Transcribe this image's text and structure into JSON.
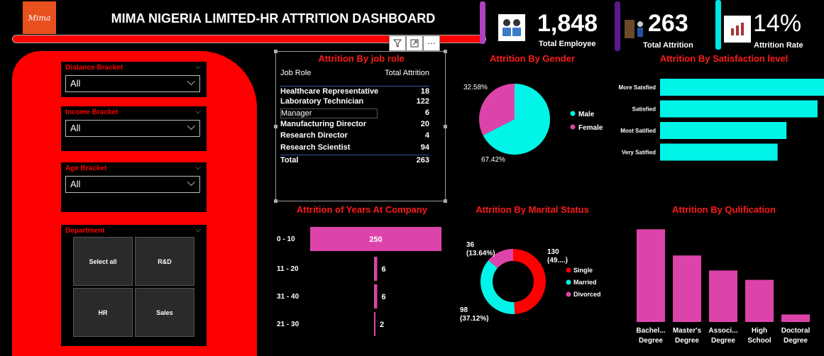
{
  "header": {
    "logo_text": "Mima",
    "title": "MIMA NIGERIA LIMITED-HR ATTRITION DASHBOARD"
  },
  "visual_toolbar": [
    "filter-icon",
    "focus-mode-icon",
    "more-options-icon"
  ],
  "kpis": [
    {
      "value": "1,848",
      "label": "Total Employee",
      "accent": "#b040c0",
      "icon": "employees-icon"
    },
    {
      "value": "263",
      "label": "Total Attrition",
      "accent": "#5a1a8a",
      "icon": "exit-icon"
    },
    {
      "value": "14%",
      "label": "Attrition Rate",
      "accent": "#00e5e5",
      "icon": "rate-icon"
    }
  ],
  "slicers": {
    "distance": {
      "title": "Distance Bracket",
      "value": "All"
    },
    "income": {
      "title": "Income Bracket",
      "value": "All"
    },
    "age": {
      "title": "Age Bracket",
      "value": "All"
    },
    "department": {
      "title": "Department",
      "options": [
        "Select all",
        "R&D",
        "HR",
        "Sales"
      ]
    }
  },
  "job_role": {
    "title": "Attrition By job role",
    "headers": [
      "Job Role",
      "Total Attrition"
    ],
    "rows": [
      {
        "role": "Healthcare Representative",
        "value": "18"
      },
      {
        "role": "Laboratory Technician",
        "value": "122"
      },
      {
        "role": "Manager",
        "value": "6"
      },
      {
        "role": "Manufacturing Director",
        "value": "20"
      },
      {
        "role": "Research Director",
        "value": "4"
      },
      {
        "role": "Research Scientist",
        "value": "94"
      }
    ],
    "total_label": "Total",
    "total_value": "263"
  },
  "colors": {
    "accent_red": "#ff0000",
    "cyan": "#00f5e8",
    "pink": "#dd44aa",
    "title_red": "#ff1a1a"
  },
  "chart_data": [
    {
      "type": "pie",
      "title": "Attrition By Gender",
      "categories": [
        "Male",
        "Female"
      ],
      "values": [
        67.42,
        32.58
      ],
      "labels": [
        "67.42%",
        "32.58%"
      ],
      "colors": [
        "#00f5e8",
        "#dd44aa"
      ],
      "legend": "right"
    },
    {
      "type": "bar",
      "orientation": "horizontal",
      "title": "Attrition By Satisfaction level",
      "categories": [
        "More Satsfied",
        "Satisfied",
        "Most Satified",
        "Very Satified"
      ],
      "values": [
        77,
        71,
        57,
        53
      ],
      "xlim": [
        0,
        80
      ],
      "color": "#00f5e8"
    },
    {
      "type": "bar",
      "orientation": "horizontal",
      "title": "Attrition of Years At Company",
      "categories": [
        "0 - 10",
        "11 - 20",
        "31 - 40",
        "21 - 30"
      ],
      "values": [
        250,
        6,
        6,
        2
      ],
      "data_labels": [
        "250",
        "6",
        "6",
        "2"
      ],
      "xlim": [
        0,
        250
      ],
      "color": "#dd44aa"
    },
    {
      "type": "pie",
      "donut": true,
      "title": "Attrition By Marital Status",
      "categories": [
        "Single",
        "Married",
        "Divorced"
      ],
      "values": [
        130,
        98,
        36
      ],
      "labels": [
        "130\n(49....)",
        "98\n(37.12%)",
        "36\n(13.64%)"
      ],
      "colors": [
        "#ff0000",
        "#00f5e8",
        "#dd44aa"
      ],
      "legend": "right"
    },
    {
      "type": "bar",
      "title": "Attrition By Qulification",
      "categories": [
        "Bachel... Degree",
        "Master's Degree",
        "Associ... Degree",
        "High School",
        "Doctoral Degree"
      ],
      "values": [
        99,
        71,
        55,
        45,
        8
      ],
      "ylim": [
        0,
        100
      ],
      "color": "#dd44aa"
    }
  ]
}
